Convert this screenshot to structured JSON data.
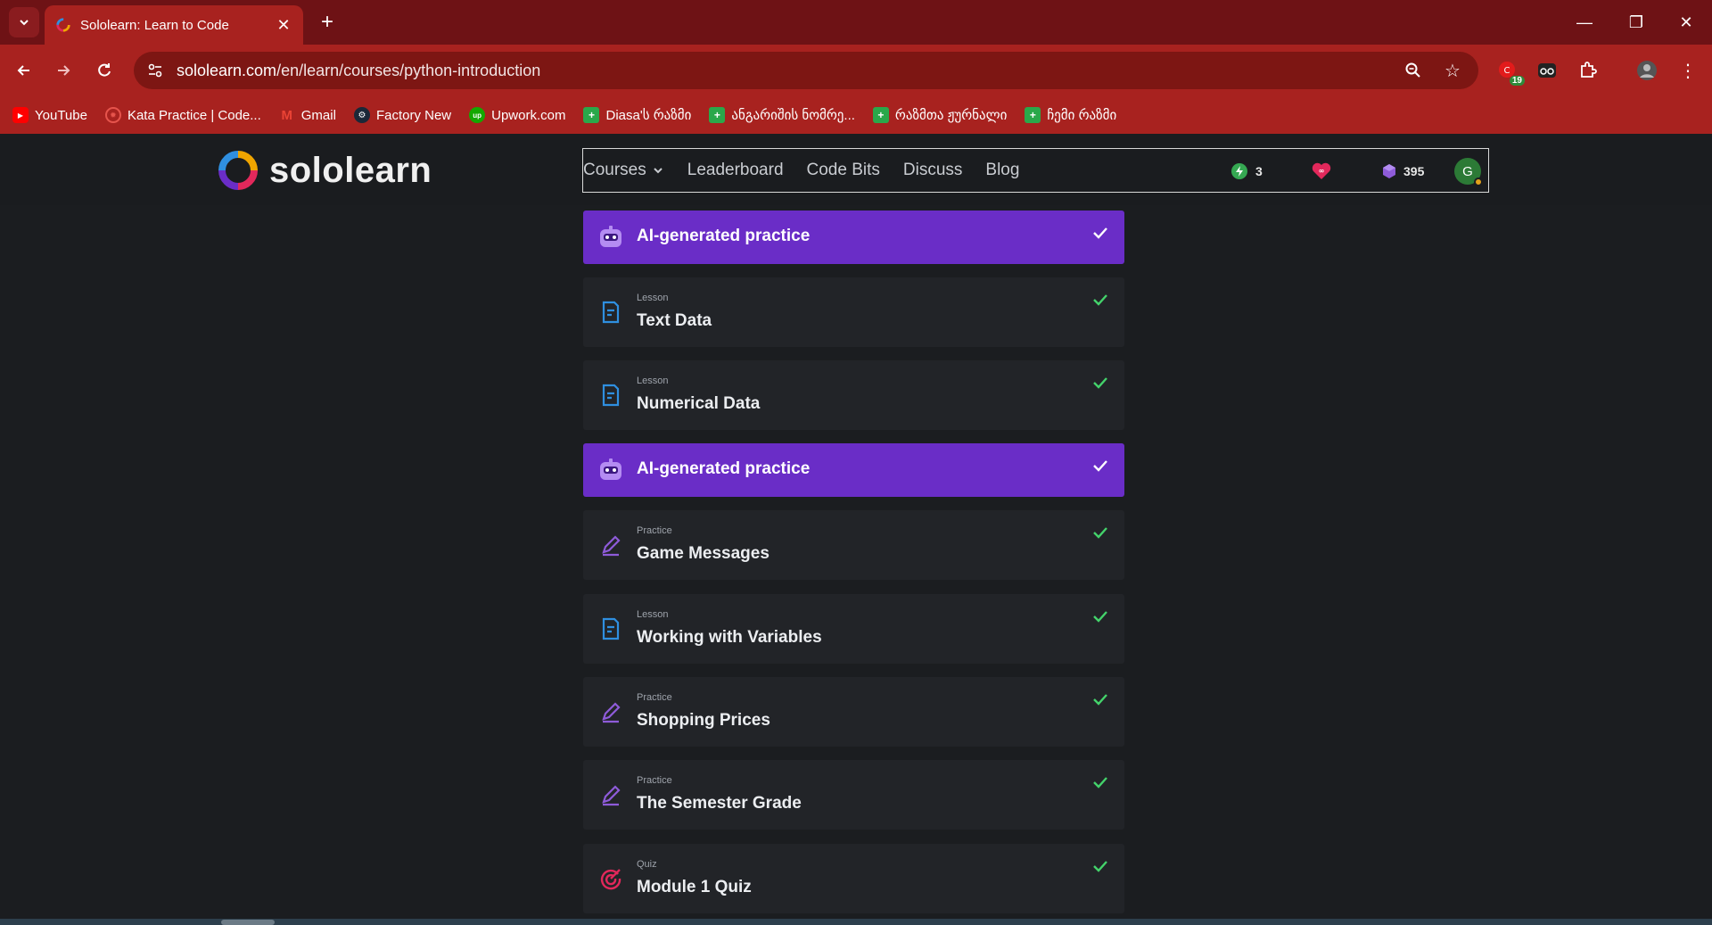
{
  "browser": {
    "tab_title": "Sololearn: Learn to Code",
    "url_host": "sololearn.com",
    "url_path": "/en/learn/courses/python-introduction",
    "notification_badge": "19",
    "bookmarks": [
      {
        "label": "YouTube",
        "icon": "youtube-icon"
      },
      {
        "label": "Kata Practice | Code...",
        "icon": "codewars-icon"
      },
      {
        "label": "Gmail",
        "icon": "gmail-icon"
      },
      {
        "label": "Factory New",
        "icon": "steam-icon"
      },
      {
        "label": "Upwork.com",
        "icon": "upwork-icon"
      },
      {
        "label": "Diasa'ს რაზმი",
        "icon": "plus-square-icon"
      },
      {
        "label": "ანგარიშის ნომრე...",
        "icon": "plus-square-icon"
      },
      {
        "label": "რაზმთა ჟურნალი",
        "icon": "plus-square-icon"
      },
      {
        "label": "ჩემი რაზმი",
        "icon": "plus-square-icon"
      }
    ]
  },
  "site": {
    "logo_text": "sololearn",
    "nav": {
      "courses": "Courses",
      "leaderboard": "Leaderboard",
      "code_bits": "Code Bits",
      "discuss": "Discuss",
      "blog": "Blog"
    },
    "stats": {
      "streak": "3",
      "gems": "395"
    },
    "avatar_letter": "G"
  },
  "colors": {
    "accent_purple": "#6a2dc7",
    "check_green": "#44d36b",
    "lesson_blue": "#2f8fe0",
    "practice_purple": "#8e5bd9",
    "quiz_red": "#e2285b"
  },
  "items": [
    {
      "type": "ai",
      "kind": "",
      "title": "AI-generated practice",
      "completed": true
    },
    {
      "type": "lesson",
      "kind": "Lesson",
      "title": "Text Data",
      "completed": true
    },
    {
      "type": "lesson",
      "kind": "Lesson",
      "title": "Numerical Data",
      "completed": true
    },
    {
      "type": "ai",
      "kind": "",
      "title": "AI-generated practice",
      "completed": true
    },
    {
      "type": "practice",
      "kind": "Practice",
      "title": "Game Messages",
      "completed": true
    },
    {
      "type": "lesson",
      "kind": "Lesson",
      "title": "Working with Variables",
      "completed": true
    },
    {
      "type": "practice",
      "kind": "Practice",
      "title": "Shopping Prices",
      "completed": true
    },
    {
      "type": "practice",
      "kind": "Practice",
      "title": "The Semester Grade",
      "completed": true
    },
    {
      "type": "quiz",
      "kind": "Quiz",
      "title": "Module 1 Quiz",
      "completed": true
    }
  ]
}
